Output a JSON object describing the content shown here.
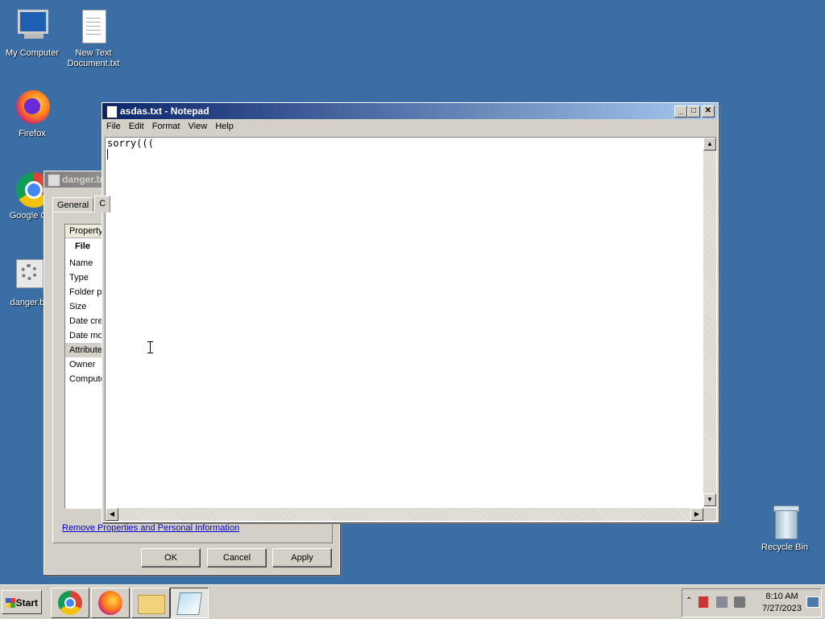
{
  "desktop": {
    "icons": [
      {
        "label": "My Computer"
      },
      {
        "label": "New Text Document.txt"
      },
      {
        "label": "Firefox"
      },
      {
        "label": "Google Chr"
      },
      {
        "label": "danger.b"
      },
      {
        "label": "Recycle Bin"
      }
    ]
  },
  "properties_dialog": {
    "title": "danger.b",
    "tabs": [
      "General",
      "C"
    ],
    "list_header": "Property",
    "group": "File",
    "rows": [
      "Name",
      "Type",
      "Folder p",
      "Size",
      "Date cre",
      "Date mo",
      "Attribute",
      "Owner",
      "Compute"
    ],
    "remove_link": "Remove Properties and Personal Information",
    "buttons": {
      "ok": "OK",
      "cancel": "Cancel",
      "apply": "Apply"
    }
  },
  "notepad": {
    "title": "asdas.txt - Notepad",
    "menu": [
      "File",
      "Edit",
      "Format",
      "View",
      "Help"
    ],
    "content": "sorry((("
  },
  "taskbar": {
    "start_label": "Start",
    "clock_time": "8:10 AM",
    "clock_date": "7/27/2023"
  }
}
